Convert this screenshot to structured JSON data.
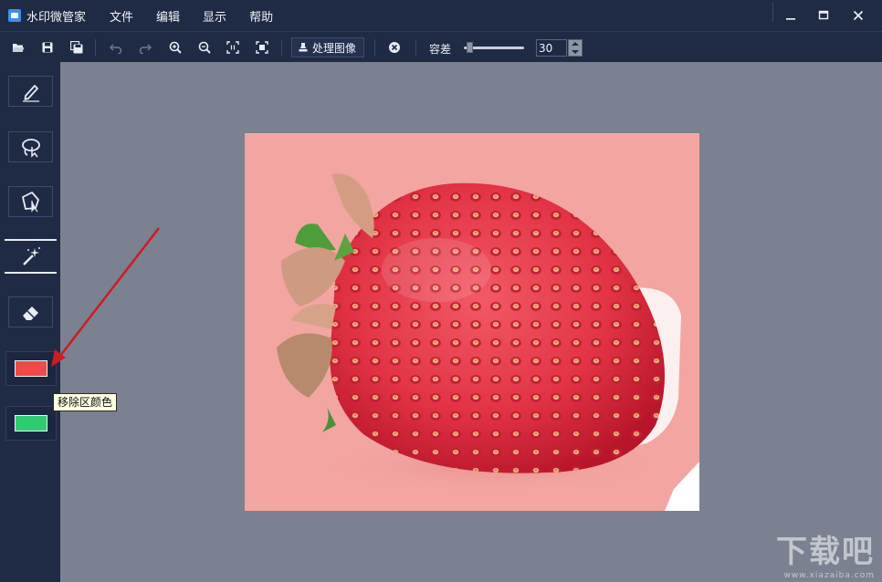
{
  "app": {
    "title": "水印微管家",
    "menu": [
      "文件",
      "编辑",
      "显示",
      "帮助"
    ],
    "window_controls": {
      "minimize_icon": "minimize-icon",
      "maximize_icon": "maximize-icon",
      "close_icon": "close-icon"
    }
  },
  "toolbar": {
    "buttons": [
      "open-icon",
      "save-icon",
      "save-as-icon",
      "undo-icon",
      "redo-icon",
      "zoom-in-icon",
      "zoom-out-icon",
      "actual-size-icon",
      "fit-window-icon"
    ],
    "process_label": "处理图像",
    "cancel_icon": "cancel-icon",
    "tolerance_label": "容差",
    "tolerance_value": "30",
    "tolerance_slider_fraction": 0.05
  },
  "tools": [
    {
      "name": "brush-tool",
      "icon": "pen-icon"
    },
    {
      "name": "lasso-tool",
      "icon": "lasso-icon"
    },
    {
      "name": "polygon-select-tool",
      "icon": "polygon-select-icon"
    },
    {
      "name": "magic-wand-tool",
      "icon": "magic-wand-icon",
      "active": true
    },
    {
      "name": "eraser-tool",
      "icon": "eraser-icon"
    }
  ],
  "colors": {
    "remove_area": "#ee4a4a",
    "keep_area": "#2ecc71",
    "canvas_bg": "#7b8190",
    "panel_bg": "#1f2a44",
    "mask_pink": "#f3a5a2",
    "annotation_arrow": "#cc1c24"
  },
  "tooltip": {
    "text": "移除区颜色"
  },
  "watermark": {
    "main": "下载吧",
    "url": "www.xiazaiba.com"
  }
}
